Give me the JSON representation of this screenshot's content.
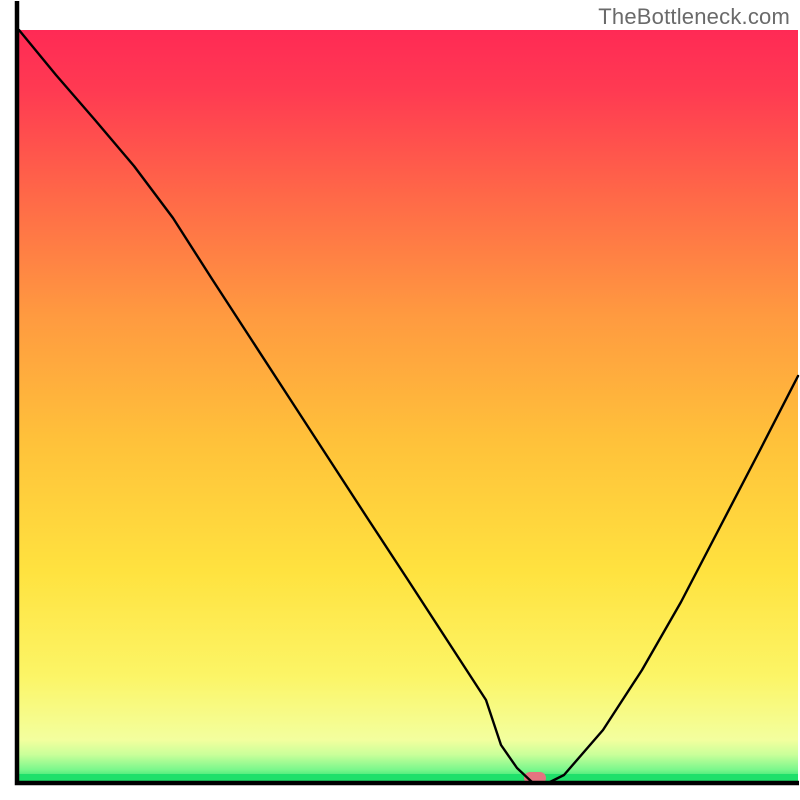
{
  "watermark": "TheBottleneck.com",
  "chart_data": {
    "type": "line",
    "title": "",
    "xlabel": "",
    "ylabel": "",
    "xlim": [
      0,
      100
    ],
    "ylim": [
      0,
      100
    ],
    "x": [
      0,
      5,
      10,
      15,
      20,
      25,
      30,
      35,
      40,
      45,
      50,
      55,
      60,
      62,
      64,
      66,
      68,
      70,
      75,
      80,
      85,
      90,
      95,
      100
    ],
    "values": [
      100,
      94,
      88,
      82,
      75,
      67,
      59,
      51,
      43,
      35,
      27,
      19,
      11,
      5,
      2,
      0,
      0,
      1,
      7,
      15,
      24,
      34,
      44,
      54
    ],
    "min_marker": {
      "x": 66,
      "y": 0
    },
    "gradient": {
      "top": "#ff2a55",
      "mid": "#ffd23a",
      "bottom": "#f6ffa6"
    },
    "green_strip_color": "#1fe06b"
  }
}
